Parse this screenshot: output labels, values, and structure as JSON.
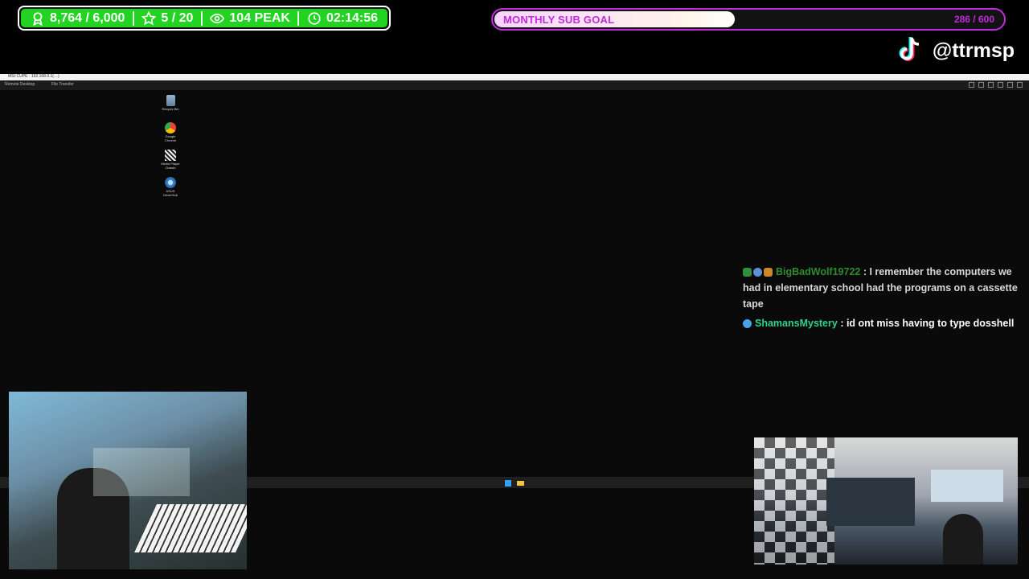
{
  "overlay": {
    "stats": {
      "followers": "8,764 / 6,000",
      "subs": "5 / 20",
      "viewers": "104 PEAK",
      "uptime": "02:14:56"
    },
    "sub_goal": {
      "label": "MONTHLY SUB GOAL",
      "count": "286 / 600",
      "progress": 0.477
    },
    "tiktok": {
      "handle": "@ttrmsp"
    }
  },
  "remote_desktop": {
    "window_title": "MSI·CUPE · 192.168.0.1(…)",
    "toolbar_tabs": [
      "Remote Desktop",
      "File Transfer"
    ],
    "desktop_icons": [
      {
        "name": "recycle-bin",
        "label": "Recycle Bin"
      },
      {
        "name": "chrome",
        "label": "Google Chrome"
      },
      {
        "name": "media-player",
        "label": "Media Player Classic"
      },
      {
        "name": "drive-hub",
        "label": "ASUS DriverHub"
      }
    ]
  },
  "chat": {
    "messages": [
      {
        "user": "BigBadWolf19722",
        "text": ": I remember the computers we had in elementary school had the programs on a cassette tape"
      },
      {
        "user": "ShamansMystery",
        "text": ": id ont miss having to type dosshell"
      }
    ]
  },
  "colors": {
    "stats_green": "#22d322",
    "goal_purple": "#c12bd9",
    "chat_user1": "#2e8b2e",
    "chat_user2": "#31d18f"
  }
}
